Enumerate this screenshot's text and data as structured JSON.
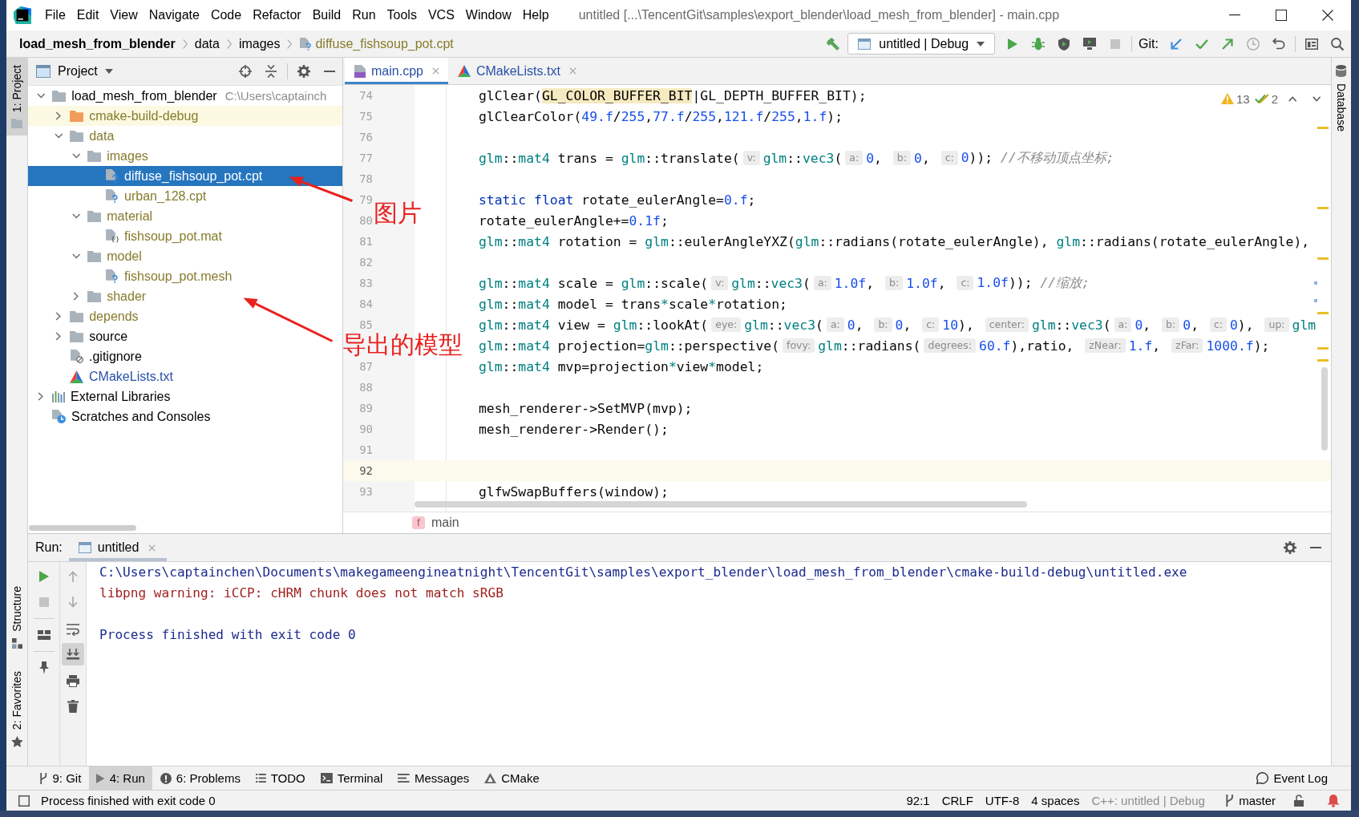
{
  "title_bar": {
    "menus": [
      "File",
      "Edit",
      "View",
      "Navigate",
      "Code",
      "Refactor",
      "Build",
      "Run",
      "Tools",
      "VCS",
      "Window",
      "Help"
    ],
    "title": "untitled [...\\TencentGit\\samples\\export_blender\\load_mesh_from_blender] - main.cpp"
  },
  "nav_bar": {
    "breadcrumbs": [
      {
        "label": "load_mesh_from_blender",
        "kind": "project"
      },
      {
        "label": "data",
        "kind": "folder"
      },
      {
        "label": "images",
        "kind": "folder"
      },
      {
        "label": "diffuse_fishsoup_pot.cpt",
        "kind": "file"
      }
    ],
    "run_config": "untitled | Debug",
    "git_label": "Git:"
  },
  "left_strip": {
    "top_tabs": [
      {
        "label": "1: Project",
        "kind": "project",
        "selected": true
      }
    ],
    "bottom_tabs": [
      {
        "label": "Structure",
        "kind": "structure",
        "selected": false
      },
      {
        "label": "2: Favorites",
        "kind": "favorites",
        "selected": false
      }
    ]
  },
  "project_panel": {
    "title": "Project",
    "tree": [
      {
        "label": "load_mesh_from_blender",
        "hint": "C:\\Users\\captainch",
        "kind": "module",
        "unversioned": false,
        "modified": false,
        "expanded": true,
        "selected": false,
        "children": [
          {
            "label": "cmake-build-debug",
            "kind": "excluded_folder",
            "unversioned": true,
            "modified": false,
            "expanded": false,
            "selected": false
          },
          {
            "label": "data",
            "kind": "folder",
            "unversioned": true,
            "modified": false,
            "expanded": true,
            "selected": false,
            "children": [
              {
                "label": "images",
                "kind": "folder",
                "unversioned": true,
                "modified": false,
                "expanded": true,
                "selected": false,
                "children": [
                  {
                    "label": "diffuse_fishsoup_pot.cpt",
                    "kind": "unknown_file",
                    "unversioned": true,
                    "modified": false,
                    "selected": true
                  },
                  {
                    "label": "urban_128.cpt",
                    "kind": "unknown_file",
                    "unversioned": true,
                    "modified": false,
                    "selected": false
                  }
                ]
              },
              {
                "label": "material",
                "kind": "folder",
                "unversioned": true,
                "modified": false,
                "expanded": true,
                "selected": false,
                "children": [
                  {
                    "label": "fishsoup_pot.mat",
                    "kind": "material_file",
                    "unversioned": true,
                    "modified": false,
                    "selected": false
                  }
                ]
              },
              {
                "label": "model",
                "kind": "folder",
                "unversioned": true,
                "modified": false,
                "expanded": true,
                "selected": false,
                "children": [
                  {
                    "label": "fishsoup_pot.mesh",
                    "kind": "unknown_file",
                    "unversioned": true,
                    "modified": false,
                    "selected": false
                  }
                ]
              },
              {
                "label": "shader",
                "kind": "folder",
                "unversioned": true,
                "modified": false,
                "expanded": false,
                "selected": false
              }
            ]
          },
          {
            "label": "depends",
            "kind": "folder",
            "unversioned": true,
            "modified": false,
            "expanded": false,
            "selected": false
          },
          {
            "label": "source",
            "kind": "folder",
            "unversioned": false,
            "modified": false,
            "expanded": false,
            "selected": false
          },
          {
            "label": ".gitignore",
            "kind": "ignore_file",
            "unversioned": false,
            "modified": false,
            "selected": false
          },
          {
            "label": "CMakeLists.txt",
            "kind": "cmake_file",
            "unversioned": false,
            "modified": true,
            "selected": false
          }
        ]
      },
      {
        "label": "External Libraries",
        "kind": "libraries",
        "unversioned": false,
        "modified": false,
        "expanded": false,
        "selected": false
      },
      {
        "label": "Scratches and Consoles",
        "kind": "scratches",
        "unversioned": false,
        "modified": false,
        "selected": false
      }
    ]
  },
  "editor": {
    "tabs": [
      {
        "label": "main.cpp",
        "kind": "cpp",
        "modified": true,
        "selected": true
      },
      {
        "label": "CMakeLists.txt",
        "kind": "cmake",
        "modified": true,
        "selected": false
      }
    ],
    "warnings": "13",
    "weak_warnings": "2",
    "lines": [
      {
        "number": "74",
        "current": false,
        "segments": [
          {
            "kind": "plain",
            "text": "glClear("
          },
          {
            "kind": "highlight",
            "text": "GL_COLOR_BUFFER_BIT"
          },
          {
            "kind": "plain",
            "text": "|GL_DEPTH_BUFFER_BIT);"
          }
        ]
      },
      {
        "number": "75",
        "current": false,
        "segments": [
          {
            "kind": "plain",
            "text": "glClearColor("
          },
          {
            "kind": "number",
            "text": "49.f"
          },
          {
            "kind": "plain",
            "text": "/"
          },
          {
            "kind": "number",
            "text": "255"
          },
          {
            "kind": "plain",
            "text": ","
          },
          {
            "kind": "number",
            "text": "77.f"
          },
          {
            "kind": "plain",
            "text": "/"
          },
          {
            "kind": "number",
            "text": "255"
          },
          {
            "kind": "plain",
            "text": ","
          },
          {
            "kind": "number",
            "text": "121.f"
          },
          {
            "kind": "plain",
            "text": "/"
          },
          {
            "kind": "number",
            "text": "255"
          },
          {
            "kind": "plain",
            "text": ","
          },
          {
            "kind": "number",
            "text": "1.f"
          },
          {
            "kind": "plain",
            "text": ");"
          }
        ]
      },
      {
        "number": "76",
        "current": false
      },
      {
        "number": "77",
        "current": false,
        "segments": [
          {
            "kind": "type",
            "text": "glm"
          },
          {
            "kind": "plain",
            "text": "::"
          },
          {
            "kind": "type",
            "text": "mat4"
          },
          {
            "kind": "plain",
            "text": " trans = "
          },
          {
            "kind": "type",
            "text": "glm"
          },
          {
            "kind": "plain",
            "text": "::translate("
          },
          {
            "kind": "hint",
            "text": "v:"
          },
          {
            "kind": "type",
            "text": "glm"
          },
          {
            "kind": "plain",
            "text": "::"
          },
          {
            "kind": "type",
            "text": "vec3"
          },
          {
            "kind": "plain",
            "text": "("
          },
          {
            "kind": "hint",
            "text": "a:"
          },
          {
            "kind": "number",
            "text": "0"
          },
          {
            "kind": "plain",
            "text": ", "
          },
          {
            "kind": "hint",
            "text": "b:"
          },
          {
            "kind": "number",
            "text": "0"
          },
          {
            "kind": "plain",
            "text": ", "
          },
          {
            "kind": "hint",
            "text": "c:"
          },
          {
            "kind": "number",
            "text": "0"
          },
          {
            "kind": "plain",
            "text": ")); "
          },
          {
            "kind": "comment",
            "text": "//不移动顶点坐标;"
          }
        ]
      },
      {
        "number": "78",
        "current": false
      },
      {
        "number": "79",
        "current": false,
        "segments": [
          {
            "kind": "keyword",
            "text": "static float"
          },
          {
            "kind": "plain",
            "text": " rotate_eulerAngle="
          },
          {
            "kind": "number",
            "text": "0.f"
          },
          {
            "kind": "plain",
            "text": ";"
          }
        ]
      },
      {
        "number": "80",
        "current": false,
        "segments": [
          {
            "kind": "plain",
            "text": "rotate_eulerAngle+="
          },
          {
            "kind": "number",
            "text": "0.1f"
          },
          {
            "kind": "plain",
            "text": ";"
          }
        ]
      },
      {
        "number": "81",
        "current": false,
        "segments": [
          {
            "kind": "type",
            "text": "glm"
          },
          {
            "kind": "plain",
            "text": "::"
          },
          {
            "kind": "type",
            "text": "mat4"
          },
          {
            "kind": "plain",
            "text": " rotation = "
          },
          {
            "kind": "type",
            "text": "glm"
          },
          {
            "kind": "plain",
            "text": "::eulerAngleYXZ("
          },
          {
            "kind": "type",
            "text": "glm"
          },
          {
            "kind": "plain",
            "text": "::radians(rotate_eulerAngle), "
          },
          {
            "kind": "type",
            "text": "glm"
          },
          {
            "kind": "plain",
            "text": "::radians(rotate_eulerAngle),"
          }
        ]
      },
      {
        "number": "82",
        "current": false
      },
      {
        "number": "83",
        "current": false,
        "segments": [
          {
            "kind": "type",
            "text": "glm"
          },
          {
            "kind": "plain",
            "text": "::"
          },
          {
            "kind": "type",
            "text": "mat4"
          },
          {
            "kind": "plain",
            "text": " scale = "
          },
          {
            "kind": "type",
            "text": "glm"
          },
          {
            "kind": "plain",
            "text": "::scale("
          },
          {
            "kind": "hint",
            "text": "v:"
          },
          {
            "kind": "type",
            "text": "glm"
          },
          {
            "kind": "plain",
            "text": "::"
          },
          {
            "kind": "type",
            "text": "vec3"
          },
          {
            "kind": "plain",
            "text": "("
          },
          {
            "kind": "hint",
            "text": "a:"
          },
          {
            "kind": "number",
            "text": "1.0f"
          },
          {
            "kind": "plain",
            "text": ", "
          },
          {
            "kind": "hint",
            "text": "b:"
          },
          {
            "kind": "number",
            "text": "1.0f"
          },
          {
            "kind": "plain",
            "text": ", "
          },
          {
            "kind": "hint",
            "text": "c:"
          },
          {
            "kind": "number",
            "text": "1.0f"
          },
          {
            "kind": "plain",
            "text": ")); "
          },
          {
            "kind": "comment",
            "text": "//缩放;"
          }
        ]
      },
      {
        "number": "84",
        "current": false,
        "segments": [
          {
            "kind": "type",
            "text": "glm"
          },
          {
            "kind": "plain",
            "text": "::"
          },
          {
            "kind": "type",
            "text": "mat4"
          },
          {
            "kind": "plain",
            "text": " model = trans"
          },
          {
            "kind": "operator",
            "text": "*"
          },
          {
            "kind": "plain",
            "text": "scale"
          },
          {
            "kind": "operator",
            "text": "*"
          },
          {
            "kind": "plain",
            "text": "rotation;"
          }
        ]
      },
      {
        "number": "85",
        "current": false,
        "segments": [
          {
            "kind": "type",
            "text": "glm"
          },
          {
            "kind": "plain",
            "text": "::"
          },
          {
            "kind": "type",
            "text": "mat4"
          },
          {
            "kind": "plain",
            "text": " view = "
          },
          {
            "kind": "type",
            "text": "glm"
          },
          {
            "kind": "plain",
            "text": "::lookAt("
          },
          {
            "kind": "hint",
            "text": "eye:"
          },
          {
            "kind": "type",
            "text": "glm"
          },
          {
            "kind": "plain",
            "text": "::"
          },
          {
            "kind": "type",
            "text": "vec3"
          },
          {
            "kind": "plain",
            "text": "("
          },
          {
            "kind": "hint",
            "text": "a:"
          },
          {
            "kind": "number",
            "text": "0"
          },
          {
            "kind": "plain",
            "text": ", "
          },
          {
            "kind": "hint",
            "text": "b:"
          },
          {
            "kind": "number",
            "text": "0"
          },
          {
            "kind": "plain",
            "text": ", "
          },
          {
            "kind": "hint",
            "text": "c:"
          },
          {
            "kind": "number",
            "text": "10"
          },
          {
            "kind": "plain",
            "text": "), "
          },
          {
            "kind": "hint",
            "text": "center:"
          },
          {
            "kind": "type",
            "text": "glm"
          },
          {
            "kind": "plain",
            "text": "::"
          },
          {
            "kind": "type",
            "text": "vec3"
          },
          {
            "kind": "plain",
            "text": "("
          },
          {
            "kind": "hint",
            "text": "a:"
          },
          {
            "kind": "number",
            "text": "0"
          },
          {
            "kind": "plain",
            "text": ", "
          },
          {
            "kind": "hint",
            "text": "b:"
          },
          {
            "kind": "number",
            "text": "0"
          },
          {
            "kind": "plain",
            "text": ", "
          },
          {
            "kind": "hint",
            "text": "c:"
          },
          {
            "kind": "number",
            "text": "0"
          },
          {
            "kind": "plain",
            "text": "), "
          },
          {
            "kind": "hint",
            "text": "up:"
          },
          {
            "kind": "type",
            "text": "glm"
          }
        ]
      },
      {
        "current": false,
        "segments": [
          {
            "kind": "type",
            "text": "glm"
          },
          {
            "kind": "plain",
            "text": "::"
          },
          {
            "kind": "type",
            "text": "mat4"
          },
          {
            "kind": "plain",
            "text": " projection="
          },
          {
            "kind": "type",
            "text": "glm"
          },
          {
            "kind": "plain",
            "text": "::perspective("
          },
          {
            "kind": "hint",
            "text": "fovy:"
          },
          {
            "kind": "type",
            "text": "glm"
          },
          {
            "kind": "plain",
            "text": "::radians("
          },
          {
            "kind": "hint",
            "text": "degrees:"
          },
          {
            "kind": "number",
            "text": "60.f"
          },
          {
            "kind": "plain",
            "text": "),ratio, "
          },
          {
            "kind": "hint",
            "text": "zNear:"
          },
          {
            "kind": "number",
            "text": "1.f"
          },
          {
            "kind": "plain",
            "text": ", "
          },
          {
            "kind": "hint",
            "text": "zFar:"
          },
          {
            "kind": "number",
            "text": "1000.f"
          },
          {
            "kind": "plain",
            "text": ");"
          }
        ]
      },
      {
        "number": "87",
        "current": false,
        "segments": [
          {
            "kind": "type",
            "text": "glm"
          },
          {
            "kind": "plain",
            "text": "::"
          },
          {
            "kind": "type",
            "text": "mat4"
          },
          {
            "kind": "plain",
            "text": " mvp=projection"
          },
          {
            "kind": "operator",
            "text": "*"
          },
          {
            "kind": "plain",
            "text": "view"
          },
          {
            "kind": "operator",
            "text": "*"
          },
          {
            "kind": "plain",
            "text": "model;"
          }
        ]
      },
      {
        "number": "88",
        "current": false
      },
      {
        "number": "89",
        "current": false,
        "segments": [
          {
            "kind": "plain",
            "text": "mesh_renderer->SetMVP(mvp);"
          }
        ]
      },
      {
        "number": "90",
        "current": false,
        "segments": [
          {
            "kind": "plain",
            "text": "mesh_renderer->Render();"
          }
        ]
      },
      {
        "number": "91",
        "current": false
      },
      {
        "number": "92",
        "current": true
      },
      {
        "number": "93",
        "current": false,
        "segments": [
          {
            "kind": "plain",
            "text": "glfwSwapBuffers(window);"
          }
        ]
      }
    ],
    "breadcrumb": {
      "badge": "f",
      "label": "main"
    }
  },
  "run_panel": {
    "label": "Run:",
    "tabs": [
      {
        "label": "untitled",
        "selected": true
      }
    ],
    "scroll_to_end": {
      "on": true
    },
    "console": [
      {
        "kind": "command",
        "text": "C:\\Users\\captainchen\\Documents\\makegameengineatnight\\TencentGit\\samples\\export_blender\\load_mesh_from_blender\\cmake-build-debug\\untitled.exe"
      },
      {
        "kind": "stderr",
        "text": "libpng warning: iCCP: cHRM chunk does not match sRGB"
      },
      {
        "kind": "exit",
        "text": "Process finished with exit code 0"
      }
    ]
  },
  "right_strip": {
    "tabs": [
      {
        "label": "Database",
        "kind": "database",
        "selected": false
      }
    ]
  },
  "tool_window_bar": {
    "left": [
      {
        "label": "9: Git",
        "kind": "git",
        "selected": false
      },
      {
        "label": "4: Run",
        "kind": "run",
        "selected": true
      },
      {
        "label": "6: Problems",
        "kind": "problems",
        "selected": false
      },
      {
        "label": "TODO",
        "kind": "todo",
        "selected": false
      },
      {
        "label": "Terminal",
        "kind": "terminal",
        "selected": false
      },
      {
        "label": "Messages",
        "kind": "messages",
        "selected": false
      },
      {
        "label": "CMake",
        "kind": "cmake",
        "selected": false
      }
    ],
    "right": [
      {
        "label": "Event Log",
        "kind": "event_log",
        "selected": false
      }
    ]
  },
  "status_bar": {
    "message": "Process finished with exit code 0",
    "items": [
      {
        "kind": "plain",
        "text": "92:1"
      },
      {
        "kind": "plain",
        "text": "CRLF"
      },
      {
        "kind": "plain",
        "text": "UTF-8"
      },
      {
        "kind": "plain",
        "text": "4 spaces"
      },
      {
        "kind": "muted",
        "text": "C++: untitled | Debug"
      },
      {
        "kind": "branch",
        "text": "master"
      }
    ]
  },
  "annotations": [
    {
      "text": "图片"
    },
    {
      "text": "导出的模型"
    }
  ]
}
